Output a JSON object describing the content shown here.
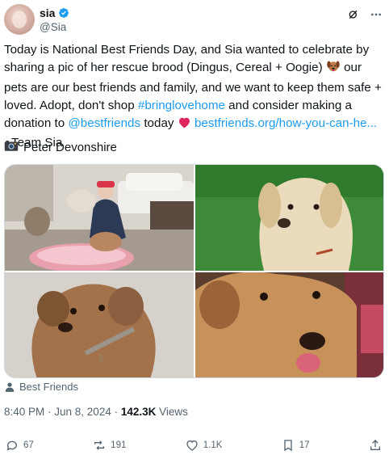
{
  "author": {
    "name": "sia",
    "handle": "@Sia"
  },
  "icons": {
    "grok": "grok-icon",
    "more": "more-dots-icon",
    "verified": "verified-badge-icon",
    "camera": "camera-emoji",
    "dog": "dog-emoji",
    "heart": "red-heart-emoji",
    "person": "person-tag-icon"
  },
  "tweet": {
    "p1": "Today is National Best Friends Day, and Sia wanted to celebrate by sharing a pic of her rescue brood (Dingus, Cereal + Oogie) ",
    "p2": " our pets are our best friends and family, and we want to keep them safe + loved. Adopt, don't shop ",
    "hashtag": "#bringlovehome",
    "p3": " and consider making a donation to ",
    "mention": "@bestfriends",
    "p4": " today ",
    "url": "bestfriends.org/how-you-can-he...",
    "p5": " - Team Sia"
  },
  "photo_credit": "Peter Devonshire",
  "tagged": "Best Friends",
  "meta": {
    "time_date": "8:40 PM · Jun 8, 2024 · ",
    "views_count": "142.3K",
    "views_label": " Views"
  },
  "actions": {
    "replies": "67",
    "reposts": "191",
    "likes": "1.1K",
    "bookmarks": "17"
  },
  "colors": {
    "link": "#1d9bf0",
    "muted": "#536471",
    "text": "#0f1419",
    "heart": "#e0245e"
  }
}
